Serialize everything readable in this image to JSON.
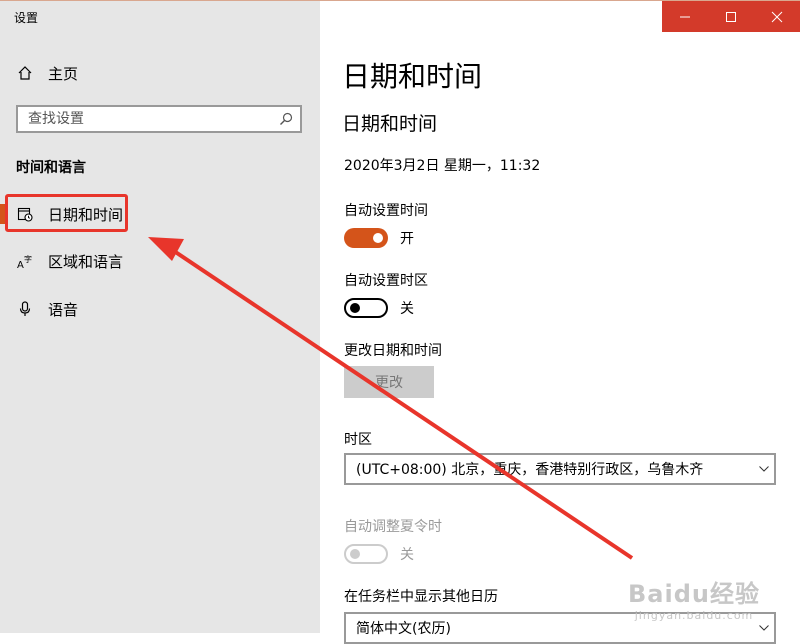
{
  "app": {
    "title": "设置"
  },
  "window_controls": {
    "minimize": "minimize-icon",
    "maximize": "maximize-icon",
    "close": "close-icon"
  },
  "sidebar": {
    "home_label": "主页",
    "search_placeholder": "查找设置",
    "section_title": "时间和语言",
    "items": [
      {
        "label": "日期和时间",
        "icon": "calendar-clock-icon",
        "active": true
      },
      {
        "label": "区域和语言",
        "icon": "language-icon"
      },
      {
        "label": "语音",
        "icon": "microphone-icon"
      }
    ]
  },
  "main": {
    "page_title": "日期和时间",
    "section_title": "日期和时间",
    "current_datetime": "2020年3月2日 星期一，11:32",
    "auto_time": {
      "label": "自动设置时间",
      "state": "开"
    },
    "auto_timezone": {
      "label": "自动设置时区",
      "state": "关"
    },
    "change_datetime": {
      "label": "更改日期和时间",
      "button": "更改"
    },
    "timezone": {
      "label": "时区",
      "value": "(UTC+08:00) 北京，重庆，香港特别行政区，乌鲁木齐"
    },
    "dst": {
      "label": "自动调整夏令时",
      "state": "关"
    },
    "calendar": {
      "label": "在任务栏中显示其他日历",
      "value": "简体中文(农历)"
    }
  },
  "watermark": {
    "logo": "Baidu经验",
    "url": "jingyan.baidu.com"
  },
  "colors": {
    "accent": "#d4541a",
    "annotation": "#e8352b",
    "sidebar_bg": "#e6e6e6"
  }
}
